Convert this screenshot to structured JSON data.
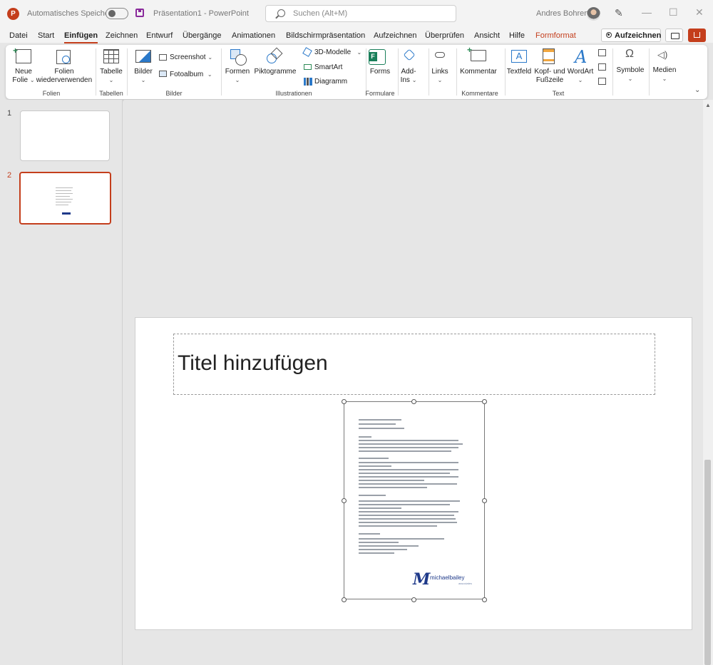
{
  "titlebar": {
    "autosave_label": "Automatisches Speichern",
    "doc_title": "Präsentation1",
    "app_name": "PowerPoint",
    "search_placeholder": "Suchen (Alt+M)",
    "user_name": "Andres Bohren",
    "logo_letter": "P"
  },
  "menu": {
    "tabs": [
      "Datei",
      "Start",
      "Einfügen",
      "Zeichnen",
      "Entwurf",
      "Übergänge",
      "Animationen",
      "Bildschirmpräsentation",
      "Aufzeichnen",
      "Überprüfen",
      "Ansicht",
      "Hilfe",
      "Formformat"
    ],
    "active_tab": "Einfügen",
    "record_button": "Aufzeichnen"
  },
  "ribbon": {
    "neue_folie_1": "Neue",
    "neue_folie_2": "Folie",
    "folien_reuse_1": "Folien",
    "folien_reuse_2": "wiederverwenden",
    "tabelle": "Tabelle",
    "bilder": "Bilder",
    "screenshot": "Screenshot",
    "fotoalbum": "Fotoalbum",
    "formen": "Formen",
    "piktogramme": "Piktogramme",
    "modelle3d": "3D-Modelle",
    "smartart": "SmartArt",
    "diagramm": "Diagramm",
    "forms": "Forms",
    "addins_1": "Add-",
    "addins_2": "Ins",
    "links": "Links",
    "kommentar": "Kommentar",
    "textfeld": "Textfeld",
    "kopf_1": "Kopf- und",
    "kopf_2": "Fußzeile",
    "wordart": "WordArt",
    "symbole": "Symbole",
    "medien": "Medien",
    "groups": {
      "folien": "Folien",
      "tabellen": "Tabellen",
      "bilder": "Bilder",
      "illustrationen": "Illustrationen",
      "formulare": "Formulare",
      "kommentare": "Kommentare",
      "text": "Text"
    }
  },
  "thumbnails": [
    {
      "number": "1",
      "active": false
    },
    {
      "number": "2",
      "active": true
    }
  ],
  "slide": {
    "title_placeholder": "Titel hinzufügen",
    "logo_name": "michaelbailey",
    "logo_sub": "associates"
  },
  "colors": {
    "accent": "#c43e1c",
    "ribbon_bg": "#ffffff",
    "window_bg": "#f3f3f3",
    "canvas_bg": "#e6e6e6",
    "logo_blue": "#1f3a8a"
  }
}
